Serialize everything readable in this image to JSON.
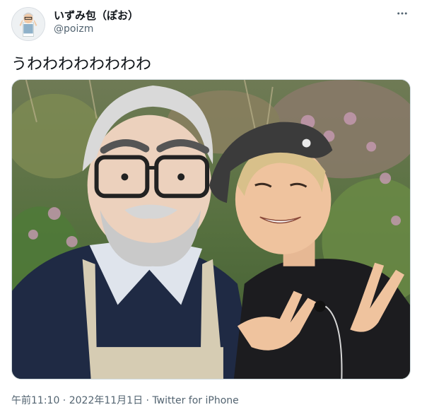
{
  "tweet": {
    "author": {
      "display_name": "いずみ包（ぽお）",
      "handle": "@poizm",
      "avatar_icon": "avatar-photo"
    },
    "more_icon": "more-horizontal-icon",
    "text": "うわわわわわわわわ",
    "media": {
      "type": "photo",
      "icon": "photo-image"
    },
    "meta": {
      "time": "午前11:10",
      "separator1": " · ",
      "date": "2022年11月1日",
      "separator2": " · ",
      "source": "Twitter for iPhone"
    }
  },
  "colors": {
    "text_primary": "#0f1419",
    "text_secondary": "#536471",
    "border": "#cfd9de",
    "background": "#ffffff"
  }
}
